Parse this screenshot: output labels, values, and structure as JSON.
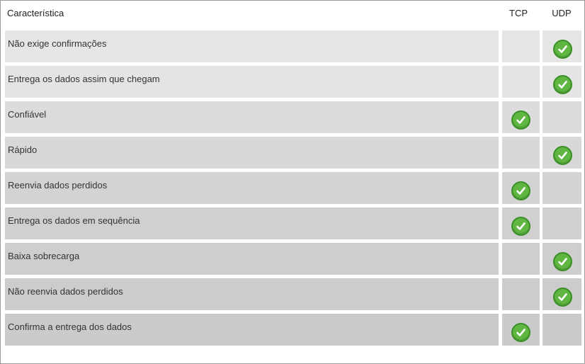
{
  "header": {
    "feature": "Característica",
    "tcp": "TCP",
    "udp": "UDP"
  },
  "icon": "checkmark-icon",
  "colors": {
    "check_fill": "#5fb641",
    "row_light": "#e6e6e6",
    "row_dark": "#cbcbcb"
  },
  "rows": [
    {
      "label": "Não exige confirmações",
      "tcp": false,
      "udp": true
    },
    {
      "label": "Entrega os dados assim que chegam",
      "tcp": false,
      "udp": true
    },
    {
      "label": "Confiável",
      "tcp": true,
      "udp": false
    },
    {
      "label": "Rápido",
      "tcp": false,
      "udp": true
    },
    {
      "label": "Reenvia dados perdidos",
      "tcp": true,
      "udp": false
    },
    {
      "label": "Entrega os dados em sequência",
      "tcp": true,
      "udp": false
    },
    {
      "label": "Baixa sobrecarga",
      "tcp": false,
      "udp": true
    },
    {
      "label": "Não reenvia dados perdidos",
      "tcp": false,
      "udp": true
    },
    {
      "label": "Confirma a entrega dos dados",
      "tcp": true,
      "udp": false
    }
  ]
}
